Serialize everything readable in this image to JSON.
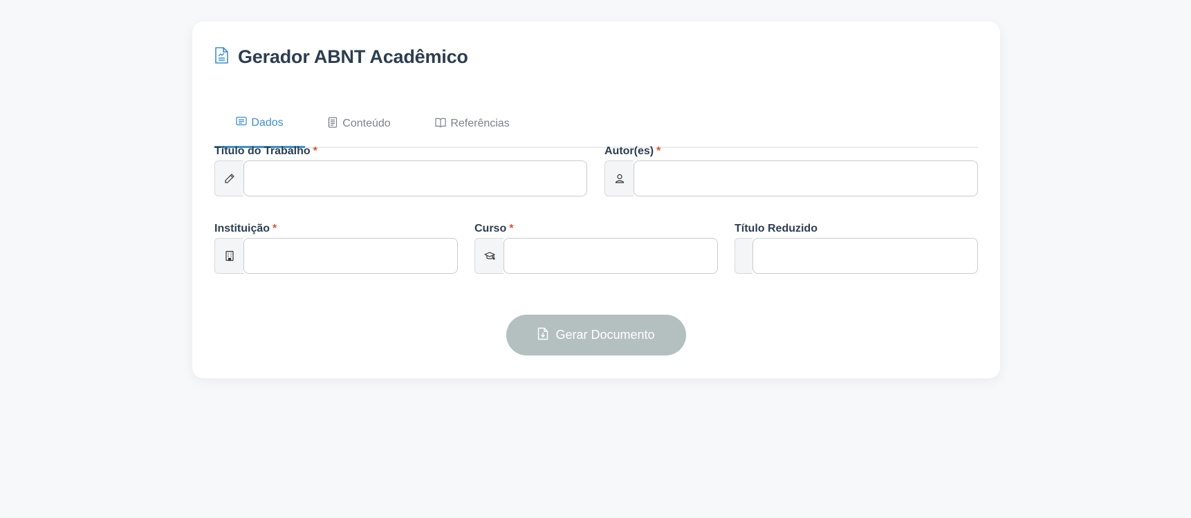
{
  "header": {
    "title": "Gerador ABNT Acadêmico",
    "icon": "document-text-icon"
  },
  "tabs": [
    {
      "label": "Dados",
      "icon": "list-card-icon",
      "active": true
    },
    {
      "label": "Conteúdo",
      "icon": "notes-icon",
      "active": false
    },
    {
      "label": "Referências",
      "icon": "book-icon",
      "active": false
    }
  ],
  "form": {
    "titulo": {
      "label": "Título do Trabalho",
      "required_mark": "*",
      "value": "",
      "icon": "pencil-icon"
    },
    "autores": {
      "label": "Autor(es)",
      "required_mark": "*",
      "value": "",
      "icon": "person-icon"
    },
    "instituicao": {
      "label": "Instituição",
      "required_mark": "*",
      "value": "",
      "icon": "building-icon"
    },
    "curso": {
      "label": "Curso",
      "required_mark": "*",
      "value": "",
      "icon": "graduation-cap-icon"
    },
    "titulo_reduzido": {
      "label": "Título Reduzido",
      "value": ""
    }
  },
  "actions": {
    "generate_label": "Gerar Documento",
    "generate_icon": "file-download-icon",
    "generate_enabled": false
  },
  "colors": {
    "accent": "#3a8fd0",
    "required": "#e74c3c",
    "button_disabled": "#b4bfbf",
    "title": "#2c3e50"
  }
}
